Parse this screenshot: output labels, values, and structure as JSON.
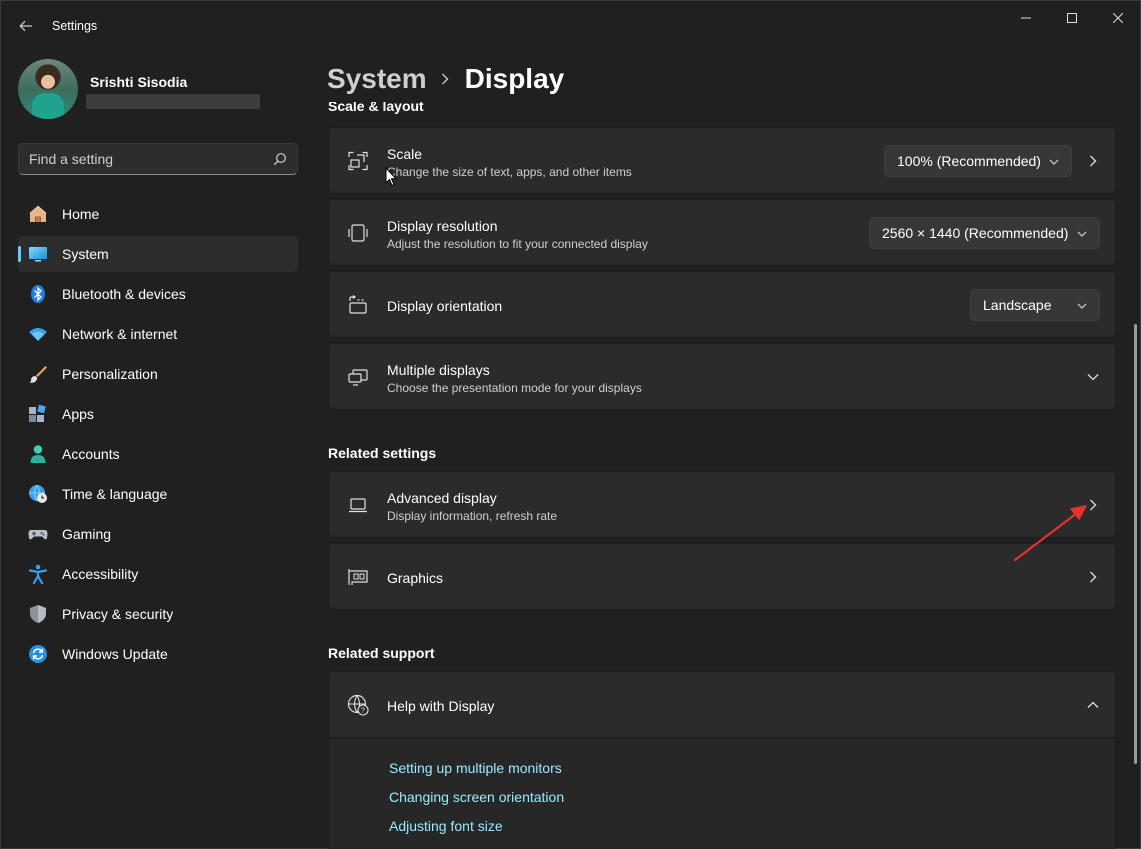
{
  "window": {
    "app_title": "Settings",
    "icons": {
      "back": "back-arrow-icon",
      "minimize": "minimize-icon",
      "maximize": "maximize-icon",
      "close": "close-icon"
    }
  },
  "profile": {
    "name": "Srishti Sisodia"
  },
  "search": {
    "placeholder": "Find a setting",
    "icon": "search-icon"
  },
  "sidebar": {
    "items": [
      {
        "label": "Home",
        "icon": "home-icon",
        "active": false
      },
      {
        "label": "System",
        "icon": "system-icon",
        "active": true
      },
      {
        "label": "Bluetooth & devices",
        "icon": "bluetooth-icon",
        "active": false
      },
      {
        "label": "Network & internet",
        "icon": "wifi-icon",
        "active": false
      },
      {
        "label": "Personalization",
        "icon": "brush-icon",
        "active": false
      },
      {
        "label": "Apps",
        "icon": "apps-icon",
        "active": false
      },
      {
        "label": "Accounts",
        "icon": "person-icon",
        "active": false
      },
      {
        "label": "Time & language",
        "icon": "globe-clock-icon",
        "active": false
      },
      {
        "label": "Gaming",
        "icon": "gamepad-icon",
        "active": false
      },
      {
        "label": "Accessibility",
        "icon": "accessibility-icon",
        "active": false
      },
      {
        "label": "Privacy & security",
        "icon": "shield-icon",
        "active": false
      },
      {
        "label": "Windows Update",
        "icon": "update-icon",
        "active": false
      }
    ],
    "accent_color": "#60cdff"
  },
  "breadcrumb": {
    "parent": "System",
    "current": "Display"
  },
  "scale_layout": {
    "section_title": "Scale & layout",
    "cards": [
      {
        "title": "Scale",
        "subtitle": "Change the size of text, apps, and other items",
        "dropdown": "100% (Recommended)",
        "icon": "scale-icon",
        "has_chevron_right": true
      },
      {
        "title": "Display resolution",
        "subtitle": "Adjust the resolution to fit your connected display",
        "dropdown": "2560 × 1440 (Recommended)",
        "icon": "resolution-icon"
      },
      {
        "title": "Display orientation",
        "dropdown": "Landscape",
        "icon": "orientation-icon"
      },
      {
        "title": "Multiple displays",
        "subtitle": "Choose the presentation mode for your displays",
        "icon": "multiple-displays-icon",
        "expander": "chevron-down-icon"
      }
    ]
  },
  "related_settings": {
    "section_title": "Related settings",
    "cards": [
      {
        "title": "Advanced display",
        "subtitle": "Display information, refresh rate",
        "icon": "laptop-icon"
      },
      {
        "title": "Graphics",
        "icon": "graphics-card-icon"
      }
    ]
  },
  "related_support": {
    "section_title": "Related support",
    "help_title": "Help with Display",
    "help_icon": "globe-help-icon",
    "links": [
      "Setting up multiple monitors",
      "Changing screen orientation",
      "Adjusting font size"
    ],
    "link_color": "#99ebff"
  },
  "annotation": {
    "arrow_color": "#e8312f",
    "points_to": "Advanced display chevron"
  }
}
